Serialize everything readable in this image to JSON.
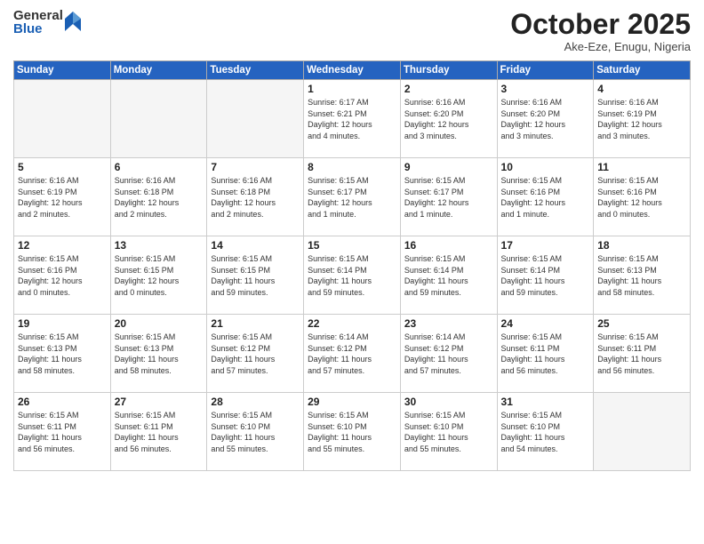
{
  "header": {
    "logo_general": "General",
    "logo_blue": "Blue",
    "month_title": "October 2025",
    "location": "Ake-Eze, Enugu, Nigeria"
  },
  "weekdays": [
    "Sunday",
    "Monday",
    "Tuesday",
    "Wednesday",
    "Thursday",
    "Friday",
    "Saturday"
  ],
  "weeks": [
    [
      {
        "day": "",
        "info": ""
      },
      {
        "day": "",
        "info": ""
      },
      {
        "day": "",
        "info": ""
      },
      {
        "day": "1",
        "info": "Sunrise: 6:17 AM\nSunset: 6:21 PM\nDaylight: 12 hours\nand 4 minutes."
      },
      {
        "day": "2",
        "info": "Sunrise: 6:16 AM\nSunset: 6:20 PM\nDaylight: 12 hours\nand 3 minutes."
      },
      {
        "day": "3",
        "info": "Sunrise: 6:16 AM\nSunset: 6:20 PM\nDaylight: 12 hours\nand 3 minutes."
      },
      {
        "day": "4",
        "info": "Sunrise: 6:16 AM\nSunset: 6:19 PM\nDaylight: 12 hours\nand 3 minutes."
      }
    ],
    [
      {
        "day": "5",
        "info": "Sunrise: 6:16 AM\nSunset: 6:19 PM\nDaylight: 12 hours\nand 2 minutes."
      },
      {
        "day": "6",
        "info": "Sunrise: 6:16 AM\nSunset: 6:18 PM\nDaylight: 12 hours\nand 2 minutes."
      },
      {
        "day": "7",
        "info": "Sunrise: 6:16 AM\nSunset: 6:18 PM\nDaylight: 12 hours\nand 2 minutes."
      },
      {
        "day": "8",
        "info": "Sunrise: 6:15 AM\nSunset: 6:17 PM\nDaylight: 12 hours\nand 1 minute."
      },
      {
        "day": "9",
        "info": "Sunrise: 6:15 AM\nSunset: 6:17 PM\nDaylight: 12 hours\nand 1 minute."
      },
      {
        "day": "10",
        "info": "Sunrise: 6:15 AM\nSunset: 6:16 PM\nDaylight: 12 hours\nand 1 minute."
      },
      {
        "day": "11",
        "info": "Sunrise: 6:15 AM\nSunset: 6:16 PM\nDaylight: 12 hours\nand 0 minutes."
      }
    ],
    [
      {
        "day": "12",
        "info": "Sunrise: 6:15 AM\nSunset: 6:16 PM\nDaylight: 12 hours\nand 0 minutes."
      },
      {
        "day": "13",
        "info": "Sunrise: 6:15 AM\nSunset: 6:15 PM\nDaylight: 12 hours\nand 0 minutes."
      },
      {
        "day": "14",
        "info": "Sunrise: 6:15 AM\nSunset: 6:15 PM\nDaylight: 11 hours\nand 59 minutes."
      },
      {
        "day": "15",
        "info": "Sunrise: 6:15 AM\nSunset: 6:14 PM\nDaylight: 11 hours\nand 59 minutes."
      },
      {
        "day": "16",
        "info": "Sunrise: 6:15 AM\nSunset: 6:14 PM\nDaylight: 11 hours\nand 59 minutes."
      },
      {
        "day": "17",
        "info": "Sunrise: 6:15 AM\nSunset: 6:14 PM\nDaylight: 11 hours\nand 59 minutes."
      },
      {
        "day": "18",
        "info": "Sunrise: 6:15 AM\nSunset: 6:13 PM\nDaylight: 11 hours\nand 58 minutes."
      }
    ],
    [
      {
        "day": "19",
        "info": "Sunrise: 6:15 AM\nSunset: 6:13 PM\nDaylight: 11 hours\nand 58 minutes."
      },
      {
        "day": "20",
        "info": "Sunrise: 6:15 AM\nSunset: 6:13 PM\nDaylight: 11 hours\nand 58 minutes."
      },
      {
        "day": "21",
        "info": "Sunrise: 6:15 AM\nSunset: 6:12 PM\nDaylight: 11 hours\nand 57 minutes."
      },
      {
        "day": "22",
        "info": "Sunrise: 6:14 AM\nSunset: 6:12 PM\nDaylight: 11 hours\nand 57 minutes."
      },
      {
        "day": "23",
        "info": "Sunrise: 6:14 AM\nSunset: 6:12 PM\nDaylight: 11 hours\nand 57 minutes."
      },
      {
        "day": "24",
        "info": "Sunrise: 6:15 AM\nSunset: 6:11 PM\nDaylight: 11 hours\nand 56 minutes."
      },
      {
        "day": "25",
        "info": "Sunrise: 6:15 AM\nSunset: 6:11 PM\nDaylight: 11 hours\nand 56 minutes."
      }
    ],
    [
      {
        "day": "26",
        "info": "Sunrise: 6:15 AM\nSunset: 6:11 PM\nDaylight: 11 hours\nand 56 minutes."
      },
      {
        "day": "27",
        "info": "Sunrise: 6:15 AM\nSunset: 6:11 PM\nDaylight: 11 hours\nand 56 minutes."
      },
      {
        "day": "28",
        "info": "Sunrise: 6:15 AM\nSunset: 6:10 PM\nDaylight: 11 hours\nand 55 minutes."
      },
      {
        "day": "29",
        "info": "Sunrise: 6:15 AM\nSunset: 6:10 PM\nDaylight: 11 hours\nand 55 minutes."
      },
      {
        "day": "30",
        "info": "Sunrise: 6:15 AM\nSunset: 6:10 PM\nDaylight: 11 hours\nand 55 minutes."
      },
      {
        "day": "31",
        "info": "Sunrise: 6:15 AM\nSunset: 6:10 PM\nDaylight: 11 hours\nand 54 minutes."
      },
      {
        "day": "",
        "info": ""
      }
    ]
  ]
}
